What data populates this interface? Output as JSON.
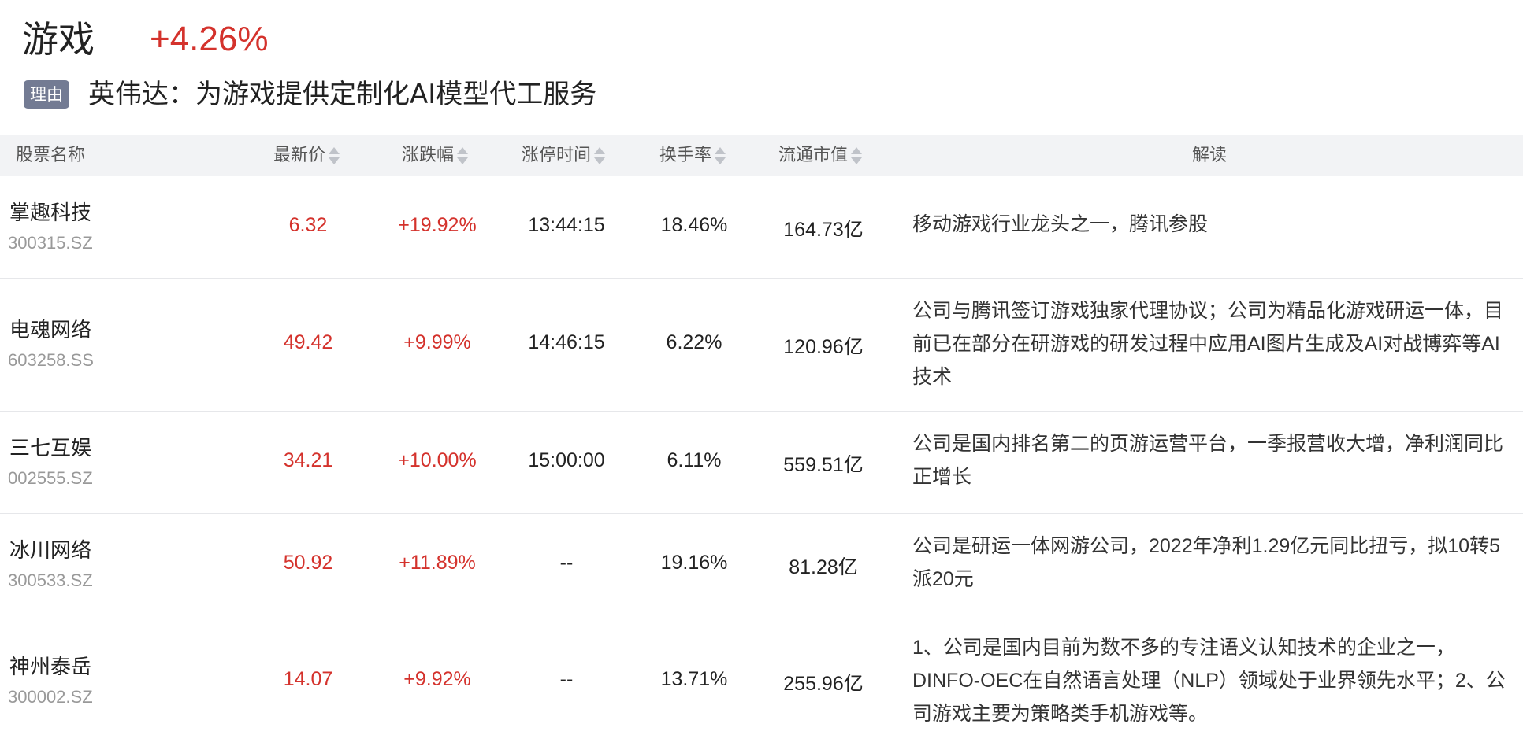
{
  "header": {
    "title": "游戏",
    "change": "+4.26%",
    "reason_badge": "理由",
    "reason_text": "英伟达：为游戏提供定制化AI模型代工服务"
  },
  "table": {
    "columns": {
      "name": "股票名称",
      "price": "最新价",
      "change": "涨跌幅",
      "limit_time": "涨停时间",
      "turnover": "换手率",
      "mkt_cap": "流通市值",
      "desc": "解读"
    },
    "rows": [
      {
        "name": "掌趣科技",
        "code": "300315.SZ",
        "price": "6.32",
        "change": "+19.92%",
        "limit_time": "13:44:15",
        "turnover": "18.46%",
        "mkt_cap": "164.73亿",
        "desc": "移动游戏行业龙头之一，腾讯参股"
      },
      {
        "name": "电魂网络",
        "code": "603258.SS",
        "price": "49.42",
        "change": "+9.99%",
        "limit_time": "14:46:15",
        "turnover": "6.22%",
        "mkt_cap": "120.96亿",
        "desc": "公司与腾讯签订游戏独家代理协议；公司为精品化游戏研运一体，目前已在部分在研游戏的研发过程中应用AI图片生成及AI对战博弈等AI技术"
      },
      {
        "name": "三七互娱",
        "code": "002555.SZ",
        "price": "34.21",
        "change": "+10.00%",
        "limit_time": "15:00:00",
        "turnover": "6.11%",
        "mkt_cap": "559.51亿",
        "desc": "公司是国内排名第二的页游运营平台，一季报营收大增，净利润同比正增长"
      },
      {
        "name": "冰川网络",
        "code": "300533.SZ",
        "price": "50.92",
        "change": "+11.89%",
        "limit_time": "--",
        "turnover": "19.16%",
        "mkt_cap": "81.28亿",
        "desc": "公司是研运一体网游公司，2022年净利1.29亿元同比扭亏，拟10转5派20元"
      },
      {
        "name": "神州泰岳",
        "code": "300002.SZ",
        "price": "14.07",
        "change": "+9.92%",
        "limit_time": "--",
        "turnover": "13.71%",
        "mkt_cap": "255.96亿",
        "desc": "1、公司是国内目前为数不多的专注语义认知技术的企业之一，DINFO-OEC在自然语言处理（NLP）领域处于业界领先水平；2、公司游戏主要为策略类手机游戏等。"
      }
    ]
  },
  "colors": {
    "up": "#d4322c",
    "badge": "#737b93",
    "header_bg": "#f2f3f5"
  },
  "icons": {
    "sort": "sort-caret-icon"
  }
}
